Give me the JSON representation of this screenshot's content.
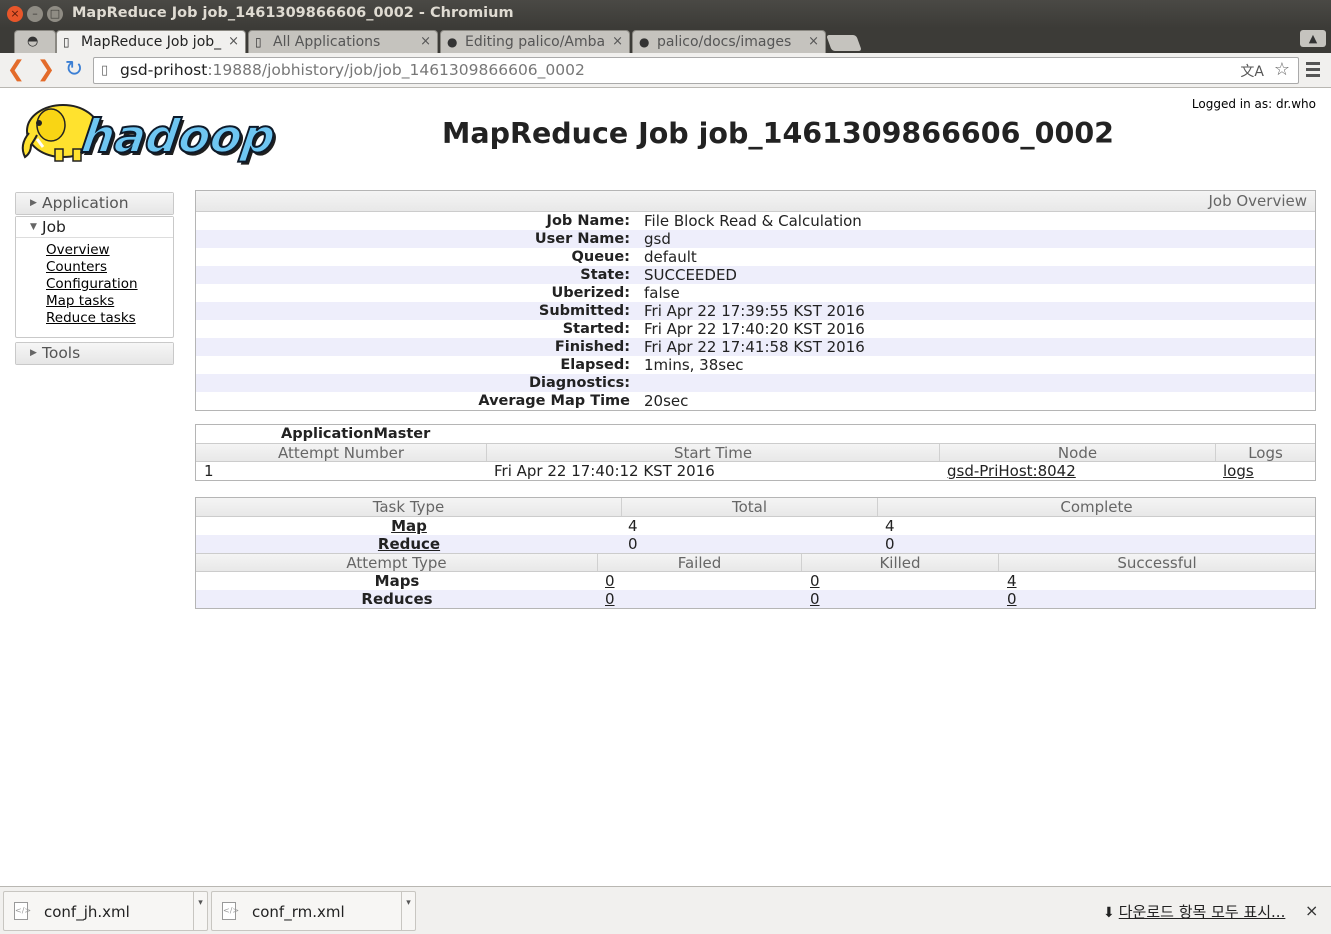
{
  "window": {
    "title": "MapReduce Job job_1461309866606_0002 - Chromium",
    "close_glyph": "×",
    "min_glyph": "–",
    "max_glyph": "□"
  },
  "tabs": [
    {
      "label": "MapReduce Job job_",
      "icon": "page-icon",
      "active": true
    },
    {
      "label": "All Applications",
      "icon": "page-icon",
      "active": false
    },
    {
      "label": "Editing palico/Amba",
      "icon": "github-icon",
      "active": false
    },
    {
      "label": "palico/docs/images",
      "icon": "github-icon",
      "active": false
    }
  ],
  "toolbar": {
    "url_host": "gsd-prihost",
    "url_path": ":19888/jobhistory/job/job_1461309866606_0002"
  },
  "page": {
    "logged_in": "Logged in as: dr.who",
    "logo_text": "hadoop",
    "title": "MapReduce Job job_1461309866606_0002"
  },
  "sidebar": {
    "application": "Application",
    "job": "Job",
    "job_links": [
      "Overview",
      "Counters",
      "Configuration",
      "Map tasks",
      "Reduce tasks"
    ],
    "tools": "Tools"
  },
  "overview": {
    "heading": "Job Overview",
    "rows": [
      {
        "key": "Job Name:",
        "value": "File Block Read & Calculation"
      },
      {
        "key": "User Name:",
        "value": "gsd"
      },
      {
        "key": "Queue:",
        "value": "default"
      },
      {
        "key": "State:",
        "value": "SUCCEEDED"
      },
      {
        "key": "Uberized:",
        "value": "false"
      },
      {
        "key": "Submitted:",
        "value": "Fri Apr 22 17:39:55 KST 2016"
      },
      {
        "key": "Started:",
        "value": "Fri Apr 22 17:40:20 KST 2016"
      },
      {
        "key": "Finished:",
        "value": "Fri Apr 22 17:41:58 KST 2016"
      },
      {
        "key": "Elapsed:",
        "value": "1mins, 38sec"
      },
      {
        "key": "Diagnostics:",
        "value": ""
      },
      {
        "key": "Average Map Time",
        "value": "20sec"
      }
    ]
  },
  "am": {
    "caption": "ApplicationMaster",
    "headers": [
      "Attempt Number",
      "Start Time",
      "Node",
      "Logs"
    ],
    "row": {
      "attempt": "1",
      "start": "Fri Apr 22 17:40:12 KST 2016",
      "node": "gsd-PriHost:8042",
      "logs": "logs"
    }
  },
  "tasks": {
    "headers": [
      "Task Type",
      "Total",
      "Complete"
    ],
    "rows": [
      {
        "type": "Map",
        "total": "4",
        "complete": "4"
      },
      {
        "type": "Reduce",
        "total": "0",
        "complete": "0"
      }
    ],
    "attempt_headers": [
      "Attempt Type",
      "Failed",
      "Killed",
      "Successful"
    ],
    "attempt_rows": [
      {
        "type": "Maps",
        "failed": "0",
        "killed": "0",
        "successful": "4"
      },
      {
        "type": "Reduces",
        "failed": "0",
        "killed": "0",
        "successful": "0"
      }
    ]
  },
  "downloads": {
    "items": [
      "conf_jh.xml",
      "conf_rm.xml"
    ],
    "show_all": "다운로드 항목 모두 표시...",
    "close_glyph": "×"
  }
}
